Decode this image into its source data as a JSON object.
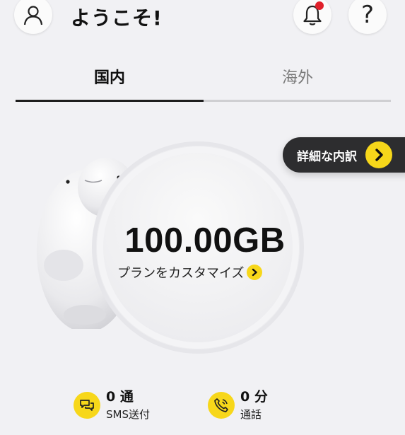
{
  "header": {
    "welcome": "ようこそ!",
    "avatar_icon": "user-outline-icon",
    "bell_icon": "bell-icon",
    "help_glyph": "?",
    "notification_dot_color": "#e0202a"
  },
  "tabs": [
    {
      "label": "国内",
      "active": true
    },
    {
      "label": "海外",
      "active": false
    }
  ],
  "data_summary": {
    "amount": "100.00GB",
    "customize_label": "プランをカスタマイズ",
    "detail_label": "詳細な内訳"
  },
  "usage": {
    "sms": {
      "value": "0 通",
      "label": "SMS送付",
      "icon": "sms-chat-icon"
    },
    "call": {
      "value": "0 分",
      "label": "通話",
      "icon": "phone-icon"
    }
  },
  "colors": {
    "accent_yellow": "#f7d71a",
    "pill_dark": "#2d2d2f",
    "background": "#f1f1f4"
  }
}
